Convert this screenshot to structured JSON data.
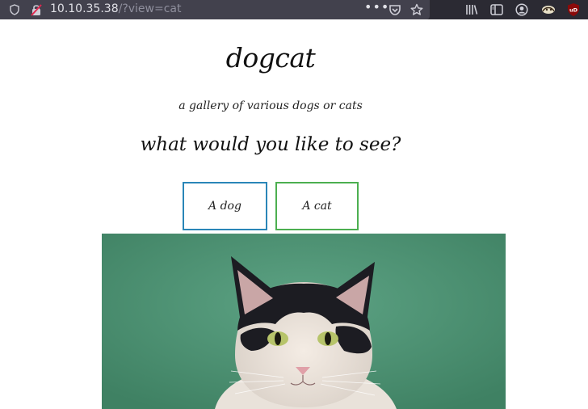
{
  "browser": {
    "url_host": "10.10.35.38",
    "url_path": "/?view=cat",
    "icons": [
      "shield-icon",
      "insecure-lock-icon",
      "more-ellipsis-icon",
      "pocket-icon",
      "bookmark-star-icon",
      "library-icon",
      "sidebar-icon",
      "account-icon",
      "extension-icon",
      "ublock-icon"
    ],
    "ublock_badge": "uD",
    "ellipsis": "•••"
  },
  "page": {
    "title": "dogcat",
    "subtitle": "a gallery of various dogs or cats",
    "question": "what would you like to see?",
    "buttons": {
      "dog": "A dog",
      "cat": "A cat"
    },
    "colors": {
      "dog_border": "#2a86b8",
      "cat_border": "#4caf50",
      "image_background": "#4f9474"
    }
  }
}
